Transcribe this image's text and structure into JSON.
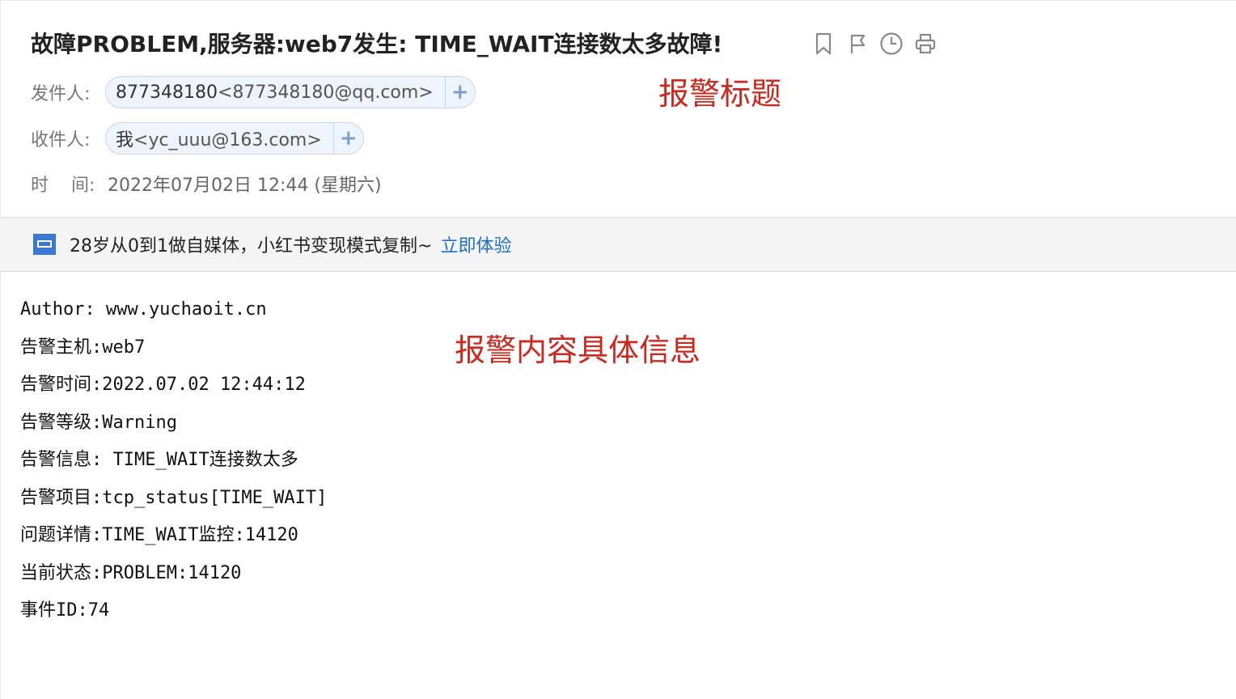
{
  "email": {
    "subject": "故障PROBLEM,服务器:web7发生: TIME_WAIT连接数太多故障!",
    "toolbar_icons": [
      "bookmark-icon",
      "flag-icon",
      "clock-icon",
      "print-icon"
    ],
    "sender": {
      "label": "发件人:",
      "name": "877348180",
      "address": "<877348180@qq.com>"
    },
    "recipient": {
      "label": "收件人:",
      "name": "我",
      "address": "<yc_uuu@163.com>"
    },
    "time": {
      "label_first": "时",
      "label_second": "间:",
      "value": "2022年07月02日 12:44 (星期六)"
    },
    "add_symbol": "+"
  },
  "ad": {
    "text": "28岁从0到1做自媒体，小红书变现模式复制~",
    "link_label": "立即体验"
  },
  "annotations": {
    "title_note": "报警标题",
    "content_note": "报警内容具体信息"
  },
  "body_lines": [
    "Author: www.yuchaoit.cn",
    "告警主机:web7",
    "告警时间:2022.07.02 12:44:12",
    "告警等级:Warning",
    "告警信息: TIME_WAIT连接数太多",
    "告警项目:tcp_status[TIME_WAIT]",
    "问题详情:TIME_WAIT监控:14120",
    "当前状态:PROBLEM:14120",
    "事件ID:74"
  ],
  "colors": {
    "annotation": "#d0261c",
    "link": "#1a6fd0",
    "chip_background": "#eef4fb"
  }
}
